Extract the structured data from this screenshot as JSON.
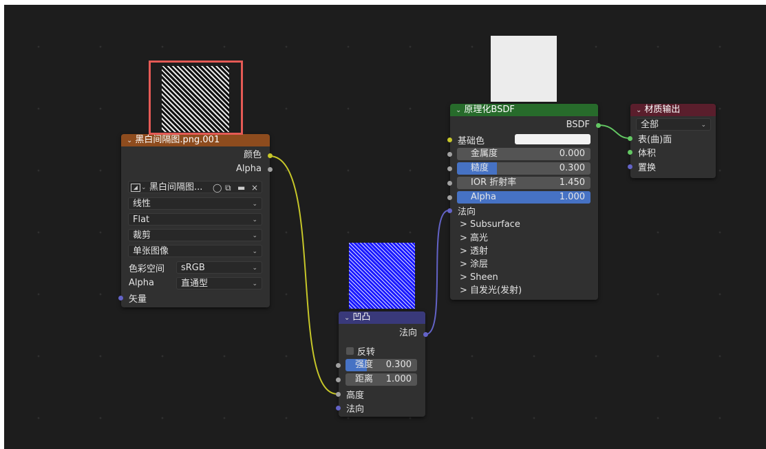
{
  "image_node": {
    "header": "黑白间隔图.png.001",
    "out_color": "颜色",
    "out_alpha": "Alpha",
    "image_name": "黑白间隔图...",
    "interpolation": "线性",
    "projection": "Flat",
    "extension": "裁剪",
    "source": "单张图像",
    "colorspace_label": "色彩空间",
    "colorspace_value": "sRGB",
    "alpha_label": "Alpha",
    "alpha_value": "直通型",
    "in_vector": "矢量",
    "header_color": "#8e4c1e"
  },
  "bump_node": {
    "header": "凹凸",
    "out_normal": "法向",
    "invert_label": "反转",
    "strength_label": "强度",
    "strength_value": "0.300",
    "distance_label": "距离",
    "distance_value": "1.000",
    "in_height": "高度",
    "in_normal": "法向",
    "header_color": "#39397a"
  },
  "bsdf_node": {
    "header": "原理化BSDF",
    "out_bsdf": "BSDF",
    "base_color_label": "基础色",
    "base_color": "#f2f2f2",
    "metallic_label": "金属度",
    "metallic_value": "0.000",
    "roughness_label": "糙度",
    "roughness_value": "0.300",
    "ior_label": "IOR 折射率",
    "ior_value": "1.450",
    "alpha_label": "Alpha",
    "alpha_value": "1.000",
    "normal_label": "法向",
    "panels": [
      "Subsurface",
      "高光",
      "透射",
      "涂层",
      "Sheen",
      "自发光(发射)"
    ],
    "header_color": "#276b2b"
  },
  "output_node": {
    "header": "材质输出",
    "target": "全部",
    "in_surface": "表(曲)面",
    "in_volume": "体积",
    "in_displacement": "置换",
    "header_color": "#5a1e2c"
  },
  "colors": {
    "highlight_box": "#e55a55",
    "wire_color": "#c7c729",
    "wire_gray": "#a1a1a1",
    "wire_vector": "#6363c7",
    "wire_shader": "#63c763"
  }
}
